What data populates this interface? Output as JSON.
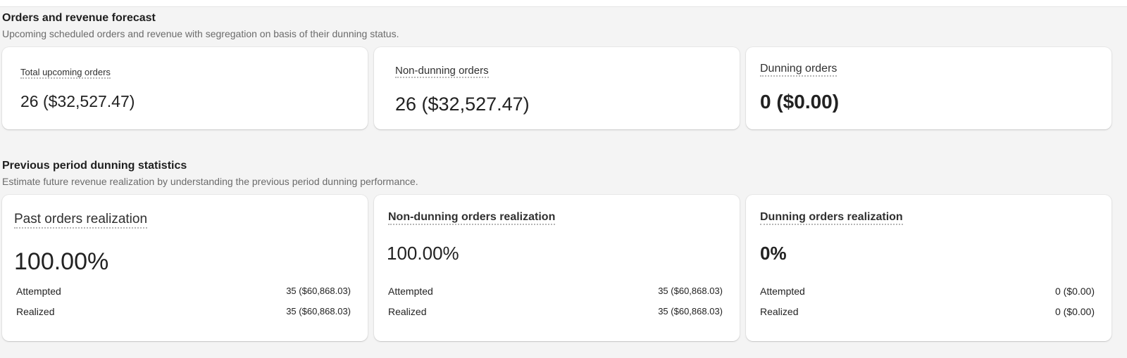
{
  "forecast": {
    "title": "Orders and revenue forecast",
    "description": "Upcoming scheduled orders and revenue with segregation on basis of their dunning status.",
    "cards": [
      {
        "label": "Total upcoming orders",
        "value": "26 ($32,527.47)"
      },
      {
        "label": "Non-dunning orders",
        "value": "26 ($32,527.47)"
      },
      {
        "label": "Dunning orders",
        "value": "0 ($0.00)"
      }
    ]
  },
  "previous": {
    "title": "Previous period dunning statistics",
    "description": "Estimate future revenue realization by understanding the previous period dunning performance.",
    "cards": [
      {
        "label": "Past orders realization",
        "value": "100.00%",
        "rows": [
          {
            "key": "Attempted",
            "value": "35 ($60,868.03)"
          },
          {
            "key": "Realized",
            "value": "35 ($60,868.03)"
          }
        ]
      },
      {
        "label": "Non-dunning orders realization",
        "value": "100.00%",
        "rows": [
          {
            "key": "Attempted",
            "value": "35 ($60,868.03)"
          },
          {
            "key": "Realized",
            "value": "35 ($60,868.03)"
          }
        ]
      },
      {
        "label": "Dunning orders realization",
        "value": "0%",
        "rows": [
          {
            "key": "Attempted",
            "value": "0 ($0.00)"
          },
          {
            "key": "Realized",
            "value": "0 ($0.00)"
          }
        ]
      }
    ]
  }
}
